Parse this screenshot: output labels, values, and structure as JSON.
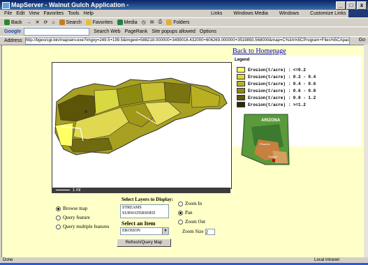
{
  "window": {
    "title": "MapServer - Walnut Gulch Application -",
    "buttons": [
      "_",
      "□",
      "x"
    ]
  },
  "menu": {
    "items": [
      "File",
      "Edit",
      "View",
      "Favorites",
      "Tools",
      "Help"
    ],
    "links": [
      "Links",
      "Windows Media",
      "Windows",
      "Customize Links"
    ]
  },
  "toolbar": {
    "nav": [
      "Back",
      "Search",
      "Favorites",
      "Media",
      "Folders"
    ],
    "google_label": "Google",
    "google_items": [
      "Search Web",
      "PageRank",
      "Site popups allowed",
      "Options"
    ]
  },
  "address": {
    "label": "Address",
    "value": "http://bgeo/cgi-bin/mapserv.exe?imgxy=249.5+199.5&imgext=588218.000000+3499016.432000+606269.000000+3519893.568000&map=C%3A%5CProgram+Files%5CApache+G",
    "go": "Go"
  },
  "content": {
    "back_link": "Back to Homepage",
    "legend": {
      "title": "Legend",
      "items": [
        {
          "label": "Erosion(t/acre) :  <=0.2",
          "color": "#ffff66"
        },
        {
          "label": "Erosion(t/acre) : 0.2 - 0.4",
          "color": "#d8d840"
        },
        {
          "label": "Erosion(t/acre) : 0.4 - 0.6",
          "color": "#b8b020"
        },
        {
          "label": "Erosion(t/acre) : 0.6 - 0.8",
          "color": "#8a8a10"
        },
        {
          "label": "Erosion(t/acre) : 0.8 - 1.2",
          "color": "#5a5a08"
        },
        {
          "label": "Erosion(t/acre) :  >=1.2",
          "color": "#2a2a00"
        }
      ],
      "state_label": "ARIZONA",
      "city_labels": [
        "Phoenix",
        "Tucson"
      ]
    },
    "scale_label": "1 mi",
    "controls": {
      "layers_heading": "Select Layers to Display:",
      "layers": [
        "STREAMS",
        "SUBWATERSHED"
      ],
      "modes": [
        {
          "label": "Browse map",
          "selected": true
        },
        {
          "label": "Query feature",
          "selected": false
        },
        {
          "label": "Query multiple features",
          "selected": false
        }
      ],
      "zoom": [
        {
          "label": "Zoom In",
          "selected": false
        },
        {
          "label": "Pan",
          "selected": true
        },
        {
          "label": "Zoom Out",
          "selected": false
        }
      ],
      "item_heading": "Select an Item",
      "item_value": "EROSION",
      "zoom_size_label": "Zoom Size",
      "zoom_size_value": "2",
      "refresh_label": "Refresh/Query Map"
    }
  },
  "status": {
    "left": "Done",
    "right": "Local intranet"
  }
}
